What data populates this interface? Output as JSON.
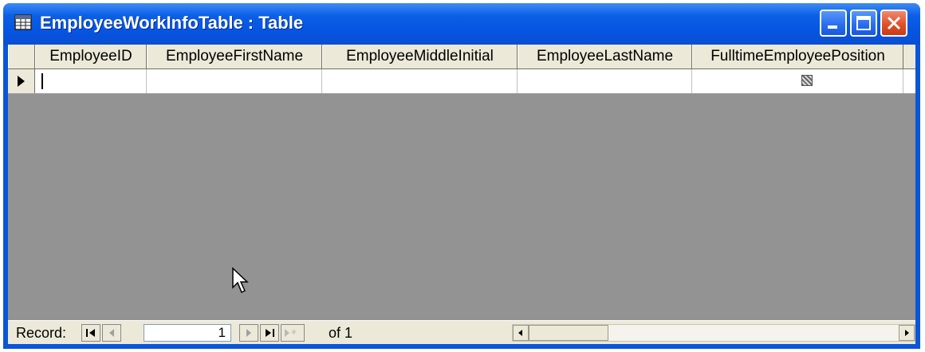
{
  "window": {
    "title": "EmployeeWorkInfoTable : Table",
    "title_icon": "table-icon",
    "buttons": [
      "minimize-icon",
      "maximize-icon",
      "close-icon"
    ]
  },
  "table": {
    "columns": [
      "EmployeeID",
      "EmployeeFirstName",
      "EmployeeMiddleInitial",
      "EmployeeLastName",
      "FulltimeEmployeePosition"
    ],
    "rows": [
      {
        "EmployeeID": "",
        "EmployeeFirstName": "",
        "EmployeeMiddleInitial": "",
        "EmployeeLastName": "",
        "FulltimeEmployeePosition": "checkbox-null"
      }
    ],
    "current_row_marker": "record-selector-arrow"
  },
  "navigation": {
    "record_label": "Record:",
    "current_record": "1",
    "of_label": "of 1"
  },
  "colors": {
    "title_bar": "#0a55d8",
    "grid_background": "#939393",
    "header_background": "#ece9d8"
  }
}
